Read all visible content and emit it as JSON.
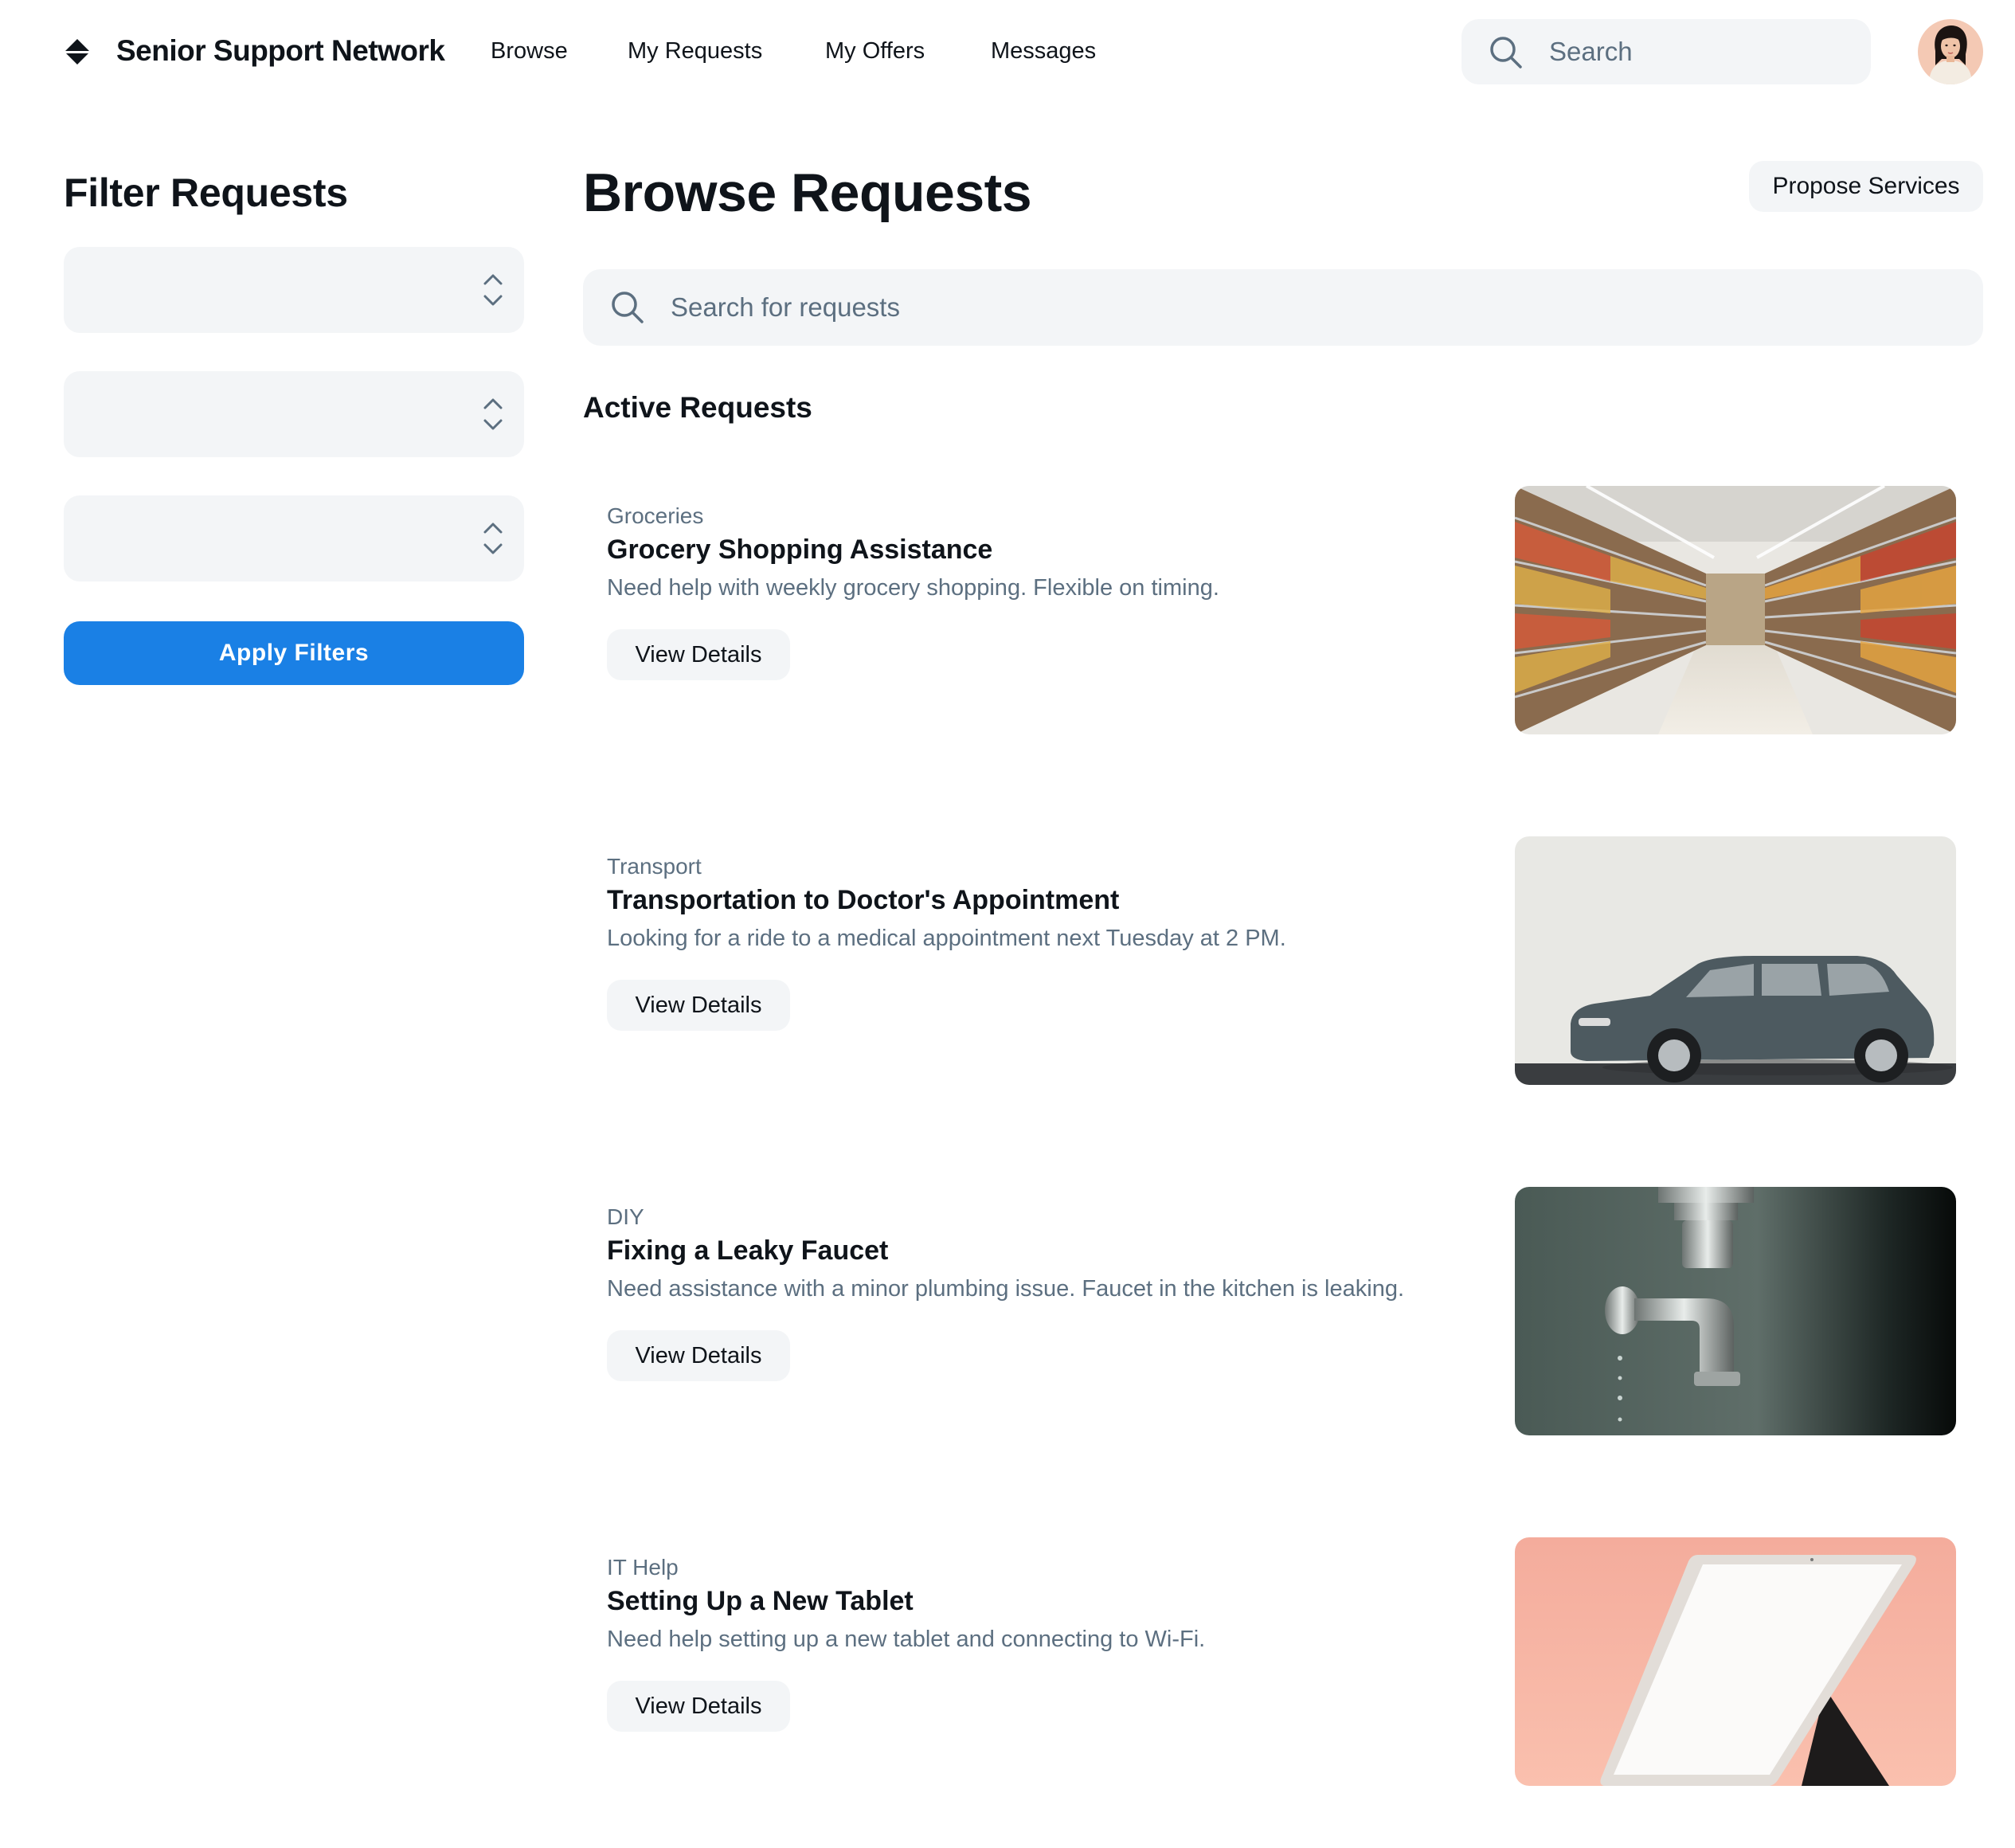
{
  "header": {
    "brand": "Senior Support Network",
    "nav": [
      "Browse",
      "My Requests",
      "My Offers",
      "Messages"
    ],
    "search_placeholder": "Search"
  },
  "sidebar": {
    "title": "Filter Requests",
    "selects": [
      {
        "value": ""
      },
      {
        "value": ""
      },
      {
        "value": ""
      }
    ],
    "apply_label": "Apply Filters"
  },
  "main": {
    "title": "Browse Requests",
    "propose_label": "Propose Services",
    "search_placeholder": "Search for requests",
    "section_title": "Active Requests",
    "requests": [
      {
        "category": "Groceries",
        "title": "Grocery Shopping Assistance",
        "description": "Need help with weekly grocery shopping. Flexible on timing.",
        "button": "View Details",
        "image": "grocery-aisle-image"
      },
      {
        "category": "Transport",
        "title": "Transportation to Doctor's Appointment",
        "description": "Looking for a ride to a medical appointment next Tuesday at 2 PM.",
        "button": "View Details",
        "image": "car-image"
      },
      {
        "category": "DIY",
        "title": "Fixing a Leaky Faucet",
        "description": "Need assistance with a minor plumbing issue. Faucet in the kitchen is leaking.",
        "button": "View Details",
        "image": "faucet-image"
      },
      {
        "category": "IT Help",
        "title": "Setting Up a New Tablet",
        "description": "Need help setting up a new tablet and connecting to Wi-Fi.",
        "button": "View Details",
        "image": "tablet-image"
      }
    ]
  },
  "colors": {
    "accent": "#1a80e5",
    "muted_text": "#5c6f80",
    "surface": "#f3f5f7",
    "text": "#0f141a"
  },
  "icons": {
    "logo": "diamond-logo-icon",
    "search": "search-icon",
    "select_chevrons": "chevron-up-down-icon"
  }
}
